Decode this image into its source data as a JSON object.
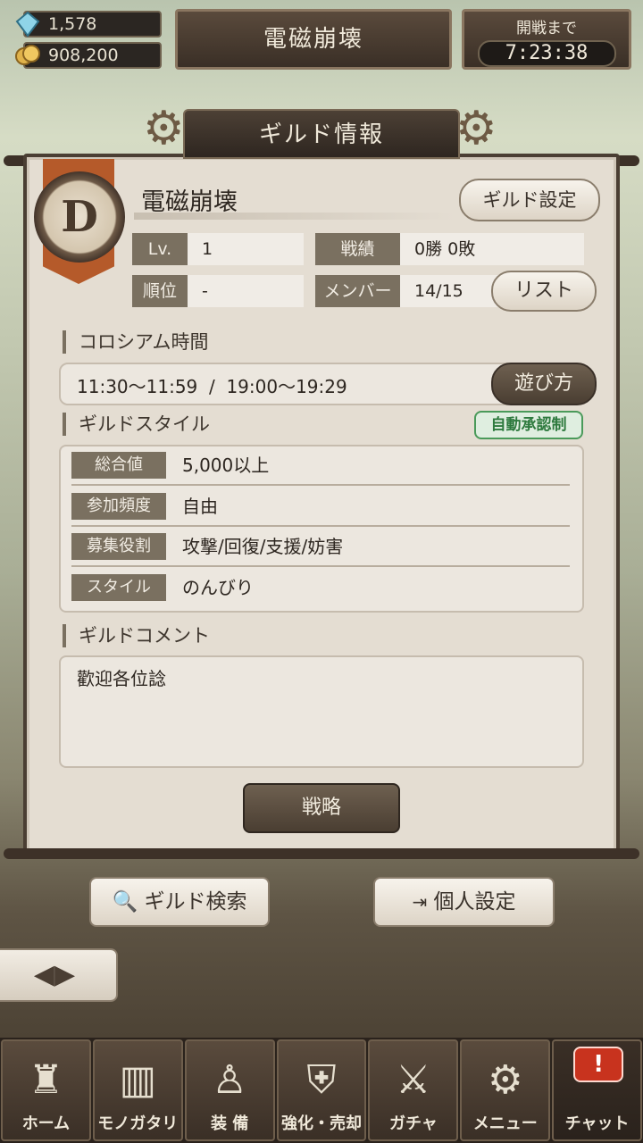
{
  "resources": {
    "gems": "1,578",
    "coins": "908,200"
  },
  "header": {
    "title": "電磁崩壊",
    "timer_label": "開戦まで",
    "timer_value": "7:23:38"
  },
  "panel": {
    "title": "ギルド情報"
  },
  "guild": {
    "rank_letter": "D",
    "name": "電磁崩壊",
    "settings_button": "ギルド設定",
    "level_label": "Lv.",
    "level_value": "1",
    "record_label": "戦績",
    "record_value": "0勝 0敗",
    "rank_label": "順位",
    "rank_value": "-",
    "member_label": "メンバー",
    "member_value": "14/15",
    "list_button": "リスト"
  },
  "colosseum": {
    "title": "コロシアム時間",
    "time": "11:30〜11:59  /  19:00〜19:29",
    "howto_button": "遊び方"
  },
  "style": {
    "title": "ギルドスタイル",
    "auto_badge": "自動承認制",
    "rows": [
      {
        "label": "総合値",
        "value": "5,000以上"
      },
      {
        "label": "参加頻度",
        "value": "自由"
      },
      {
        "label": "募集役割",
        "value": "攻撃/回復/支援/妨害"
      },
      {
        "label": "スタイル",
        "value": "のんびり"
      }
    ]
  },
  "comment": {
    "title": "ギルドコメント",
    "text": "歡迎各位諗"
  },
  "strategy_button": "戦略",
  "actions": {
    "search": "ギルド検索",
    "personal": "個人設定"
  },
  "nav": [
    {
      "label": "ホーム",
      "icon": "castle-icon"
    },
    {
      "label": "モノガタリ",
      "icon": "book-icon"
    },
    {
      "label": "装 備",
      "icon": "puppet-icon"
    },
    {
      "label": "強化・売却",
      "icon": "armor-icon"
    },
    {
      "label": "ガチャ",
      "icon": "swords-icon"
    },
    {
      "label": "メニュー",
      "icon": "gears-icon"
    },
    {
      "label": "チャット",
      "icon": "chat-alert-icon"
    }
  ]
}
